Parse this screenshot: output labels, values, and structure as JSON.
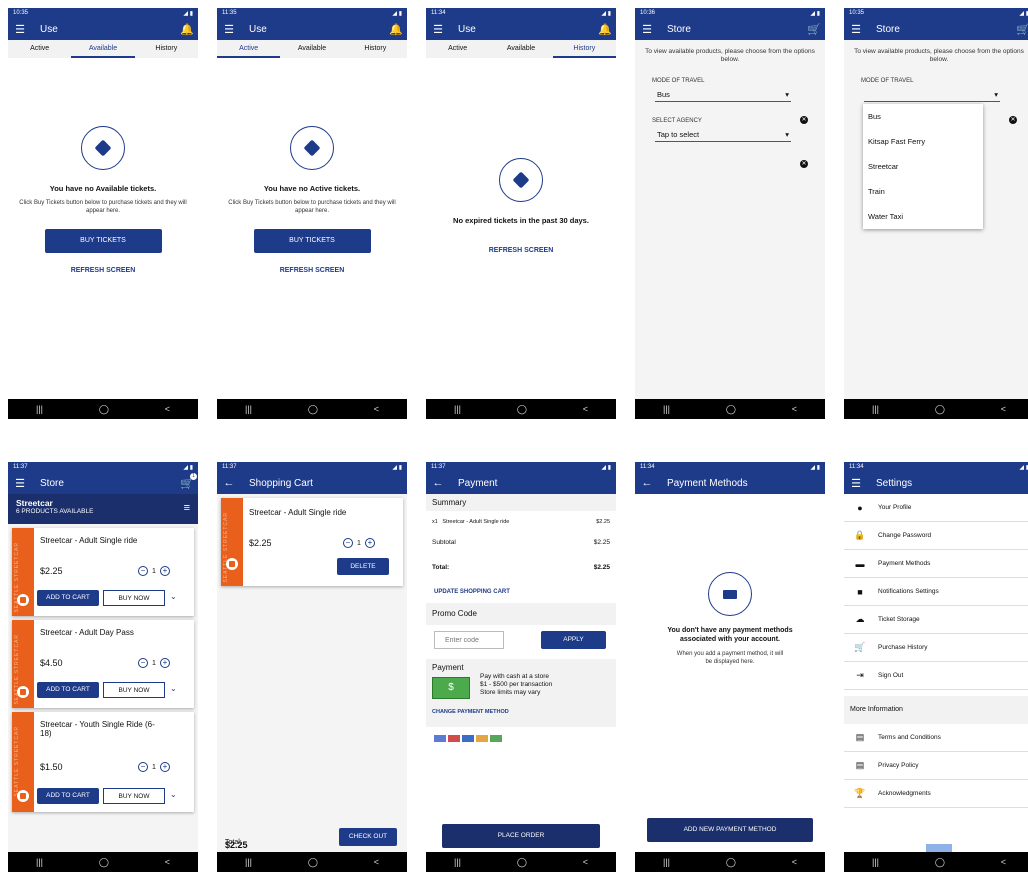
{
  "status": {
    "s1": "10:35",
    "s2": "11:35",
    "s3": "11:34",
    "s4": "10:36",
    "s5": "10:35",
    "s6": "11:37",
    "s7": "11:37",
    "s8": "11:37",
    "s9": "11:34",
    "s10": "11:34"
  },
  "use": {
    "title": "Use",
    "tabs": [
      "Active",
      "Available",
      "History"
    ],
    "available": {
      "heading": "You have no Available tickets.",
      "msg": "Click Buy Tickets button below to purchase tickets and they will appear here."
    },
    "active": {
      "heading": "You have no Active tickets.",
      "msg": "Click Buy Tickets button below to purchase tickets and they will appear here."
    },
    "history": {
      "heading": "No expired tickets in the past 30 days."
    },
    "buy": "BUY TICKETS",
    "refresh": "REFRESH SCREEN"
  },
  "store": {
    "title": "Store",
    "intro": "To view available products, please choose from the options below.",
    "mode_label": "MODE OF TRAVEL",
    "mode_value": "Bus",
    "agency_label": "SELECT AGENCY",
    "agency_value": "Tap to select",
    "options": [
      "Bus",
      "Kitsap Fast Ferry",
      "Streetcar",
      "Train",
      "Water Taxi"
    ],
    "cart_count": "1",
    "agency": "Streetcar",
    "available": "6 PRODUCTS AVAILABLE",
    "products": [
      {
        "name": "Streetcar - Adult Single ride",
        "price": "$2.25",
        "qty": "1"
      },
      {
        "name": "Streetcar - Adult Day Pass",
        "price": "$4.50",
        "qty": "1"
      },
      {
        "name": "Streetcar - Youth Single Ride (6-18)",
        "price": "$1.50",
        "qty": "1"
      }
    ],
    "add": "ADD TO CART",
    "buy_now": "BUY NOW",
    "brand": "SEATTLE STREETCAR"
  },
  "cart": {
    "title": "Shopping Cart",
    "item": "Streetcar - Adult Single ride",
    "price": "$2.25",
    "qty": "1",
    "delete": "DELETE",
    "total_label": "Total:",
    "total": "$2.25",
    "checkout": "CHECK OUT"
  },
  "payment": {
    "title": "Payment",
    "summary": "Summary",
    "qty": "x1",
    "item": "Streetcar - Adult Single ride",
    "item_price": "$2.25",
    "subtotal_label": "Subtotal",
    "subtotal": "$2.25",
    "total_label": "Total:",
    "total": "$2.25",
    "update": "UPDATE SHOPPING CART",
    "promo": "Promo Code",
    "promo_ph": "Enter code",
    "apply": "APPLY",
    "pay_label": "Payment",
    "cash1": "Pay with cash at a store",
    "cash2": "$1 - $500 per transaction",
    "cash3": "Store limits may vary",
    "change": "CHANGE PAYMENT METHOD",
    "place": "PLACE ORDER"
  },
  "methods": {
    "title": "Payment Methods",
    "heading": "You don't have any payment methods associated with your account.",
    "msg": "When you add a payment method, it will be displayed here.",
    "add": "ADD NEW PAYMENT METHOD"
  },
  "settings": {
    "title": "Settings",
    "items": [
      "Your Profile",
      "Change Password",
      "Payment Methods",
      "Notifications Settings",
      "Ticket Storage",
      "Purchase History",
      "Sign Out"
    ],
    "more": "More Information",
    "info": [
      "Terms and Conditions",
      "Privacy Policy",
      "Acknowledgments"
    ]
  }
}
